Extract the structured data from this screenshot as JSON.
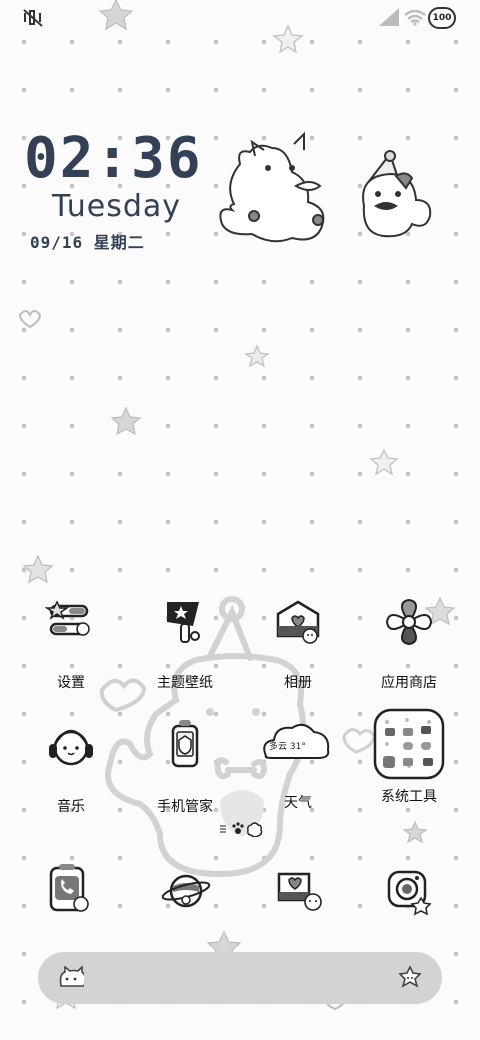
{
  "status_bar": {
    "battery": "100",
    "left_icon": "mute-vibrate-icon",
    "signal_icon": "signal-icon",
    "wifi_icon": "wifi-icon"
  },
  "clock_widget": {
    "time": "02:36",
    "weekday": "Tuesday",
    "date": "09/16 星期二"
  },
  "apps": [
    {
      "label": "设置",
      "icon": "settings-icon"
    },
    {
      "label": "主题壁纸",
      "icon": "theme-wallpaper-icon"
    },
    {
      "label": "相册",
      "icon": "gallery-icon"
    },
    {
      "label": "应用商店",
      "icon": "app-store-icon"
    },
    {
      "label": "音乐",
      "icon": "music-icon"
    },
    {
      "label": "手机管家",
      "icon": "phone-manager-icon"
    },
    {
      "label": "天气",
      "icon": "weather-icon",
      "weather_text": "多云 31°"
    },
    {
      "label": "系统工具",
      "icon": "system-tools-folder-icon"
    }
  ],
  "dock": [
    {
      "icon": "phone-icon"
    },
    {
      "icon": "browser-icon"
    },
    {
      "icon": "messages-icon"
    },
    {
      "icon": "camera-icon"
    }
  ],
  "page_indicator": "page-indicator-icon",
  "search_bar": {
    "icon_left": "cat-face-icon",
    "icon_right": "flower-icon"
  },
  "colors": {
    "clock": "#344055",
    "background": "#fbfbfb",
    "dots": "#c6c6c6",
    "search_bar": "#d3d3d3"
  }
}
